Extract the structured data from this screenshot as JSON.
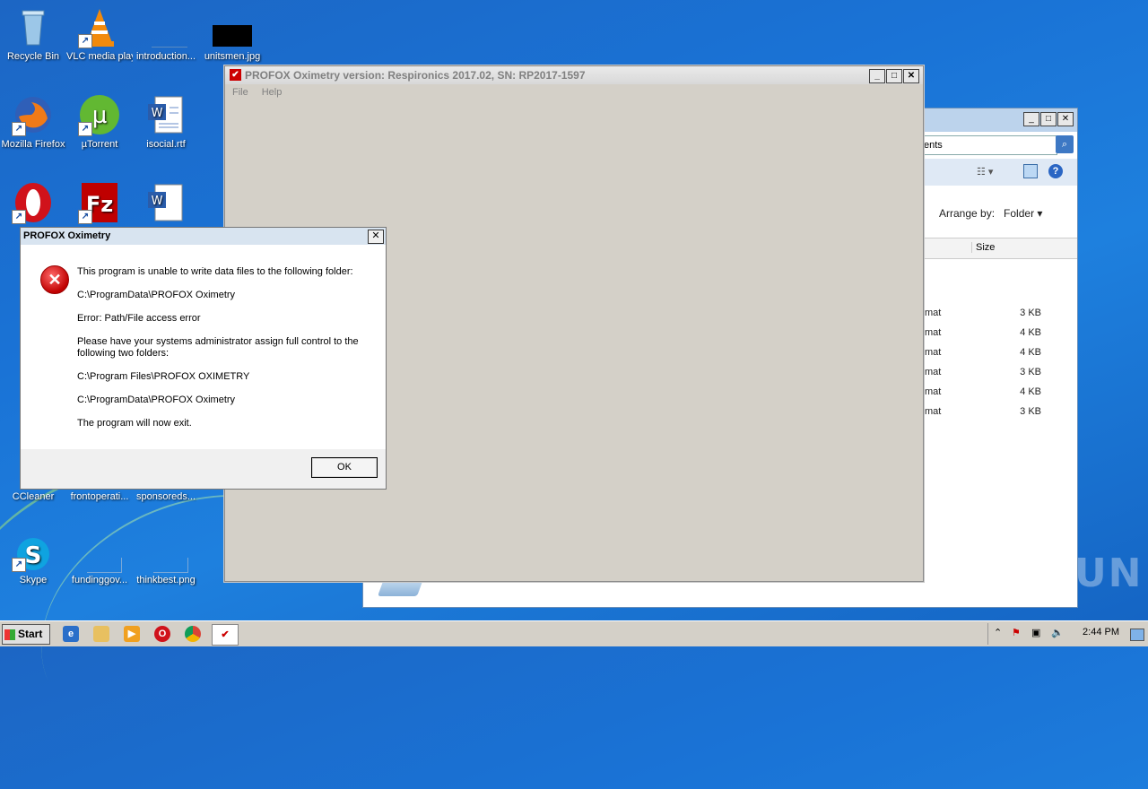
{
  "desktop": {
    "icons": [
      {
        "label": "Recycle Bin"
      },
      {
        "label": "VLC media player"
      },
      {
        "label": "introduction..."
      },
      {
        "label": "unitsmen.jpg"
      },
      {
        "label": "Mozilla Firefox"
      },
      {
        "label": "µTorrent"
      },
      {
        "label": "isocial.rtf"
      },
      {
        "label": "CCleaner"
      },
      {
        "label": "frontoperati..."
      },
      {
        "label": "sponsoreds..."
      },
      {
        "label": "Skype"
      },
      {
        "label": "fundinggov..."
      },
      {
        "label": "thinkbest.png"
      }
    ]
  },
  "explorer": {
    "address_fragment": "ents",
    "arrange_label": "Arrange by:",
    "arrange_value": "Folder",
    "size_header": "Size",
    "rows": [
      {
        "type": "mat",
        "size": "3 KB"
      },
      {
        "type": "mat",
        "size": "4 KB"
      },
      {
        "type": "mat",
        "size": "4 KB"
      },
      {
        "type": "mat",
        "size": "3 KB"
      },
      {
        "type": "mat",
        "size": "4 KB"
      },
      {
        "type": "mat",
        "size": "3 KB"
      }
    ]
  },
  "app": {
    "title": "PROFOX Oximetry version: Respironics 2017.02, SN: RP2017-1597",
    "menu": [
      "File",
      "Help"
    ]
  },
  "dialog": {
    "title": "PROFOX Oximetry",
    "lines": [
      "This program is unable to write data files to the following folder:",
      "C:\\ProgramData\\PROFOX Oximetry",
      "Error: Path/File access error",
      "Please have your systems administrator assign full control to the following two folders:",
      "C:\\Program Files\\PROFOX OXIMETRY",
      "C:\\ProgramData\\PROFOX Oximetry",
      "The program will now exit."
    ],
    "ok_label": "OK"
  },
  "taskbar": {
    "start_label": "Start",
    "clock": "2:44 PM"
  },
  "watermark": "ANY RUN"
}
